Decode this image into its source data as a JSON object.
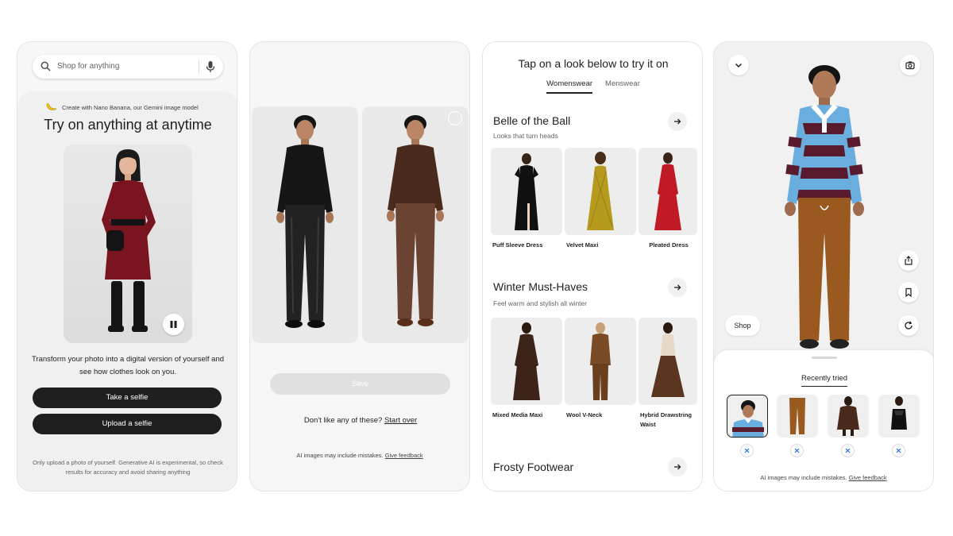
{
  "screen1": {
    "search_placeholder": "Shop for anything",
    "banana_text": "Create with Nano Banana, our Gemini image model",
    "title": "Try on anything at anytime",
    "description": "Transform your photo into a digital version of yourself and see how clothes look on you.",
    "take_selfie": "Take a selfie",
    "upload_selfie": "Upload a selfie",
    "disclaimer": "Only upload a photo of yourself. Generative AI is experimental, so check results for accuracy and avoid sharing anything"
  },
  "screen2": {
    "save_label": "Save",
    "dont_like": "Don't like any of these?",
    "start_over": "Start over",
    "ai_note": "AI images may include mistakes.",
    "give_feedback": "Give feedback"
  },
  "screen3": {
    "title": "Tap on a look below to try it on",
    "tabs": [
      {
        "label": "Womenswear",
        "active": true
      },
      {
        "label": "Menswear",
        "active": false
      }
    ],
    "sections": [
      {
        "title": "Belle of the Ball",
        "subtitle": "Looks that turn heads",
        "products": [
          "Puff Sleeve Dress",
          "Velvet Maxi",
          "Pleated Dress"
        ]
      },
      {
        "title": "Winter Must-Haves",
        "subtitle": "Feel warm and stylish all winter",
        "products": [
          "Mixed Media Maxi",
          "Wool V-Neck",
          "Hybrid Drawstring Waist"
        ]
      },
      {
        "title": "Frosty Footwear"
      }
    ]
  },
  "screen4": {
    "shop_label": "Shop",
    "recently_tried": "Recently tried",
    "ai_note": "AI images may include mistakes.",
    "give_feedback": "Give feedback"
  },
  "colors": {
    "dark_button": "#1f1f1f",
    "stripe_blue": "#6aaee0",
    "stripe_maroon": "#5a1a2e",
    "pants_brown": "#9a5a1f",
    "dress_red": "#7a1420"
  }
}
